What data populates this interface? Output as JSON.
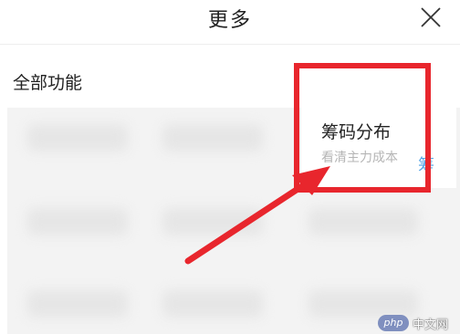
{
  "header": {
    "title": "更多",
    "close_icon": "close-icon"
  },
  "section": {
    "title": "全部功能"
  },
  "feature": {
    "title": "筹码分布",
    "subtitle": "看清主力成本",
    "peek_text": "筹"
  },
  "colors": {
    "highlight": "#e8262d",
    "accent_blue": "#4fa3e6",
    "muted_text": "#b5b5b5"
  },
  "watermark": {
    "badge": "php",
    "text": "中文网"
  }
}
